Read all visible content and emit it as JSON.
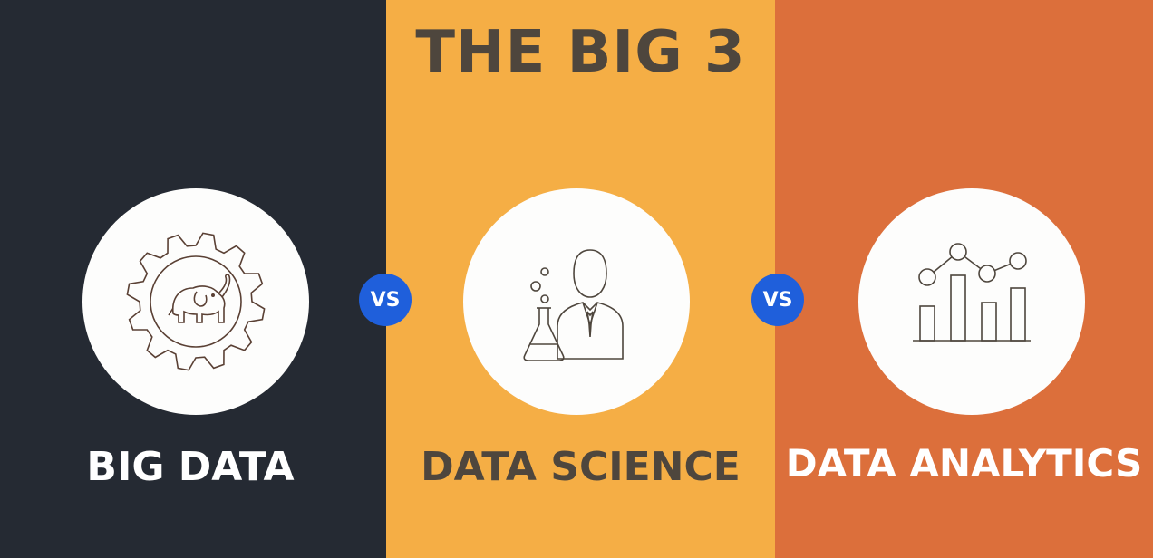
{
  "title": "THE BIG 3",
  "vs_label": "VS",
  "items": [
    {
      "label": "BIG DATA",
      "icon": "gear-elephant-icon"
    },
    {
      "label": "DATA SCIENCE",
      "icon": "scientist-flask-icon"
    },
    {
      "label": "DATA ANALYTICS",
      "icon": "bar-line-chart-icon"
    }
  ],
  "colors": {
    "panel_dark": "#252a33",
    "panel_yellow": "#f5ae45",
    "panel_orange": "#dc6f3b",
    "vs_blue": "#1f5fdb",
    "title_text": "#4e463d"
  }
}
